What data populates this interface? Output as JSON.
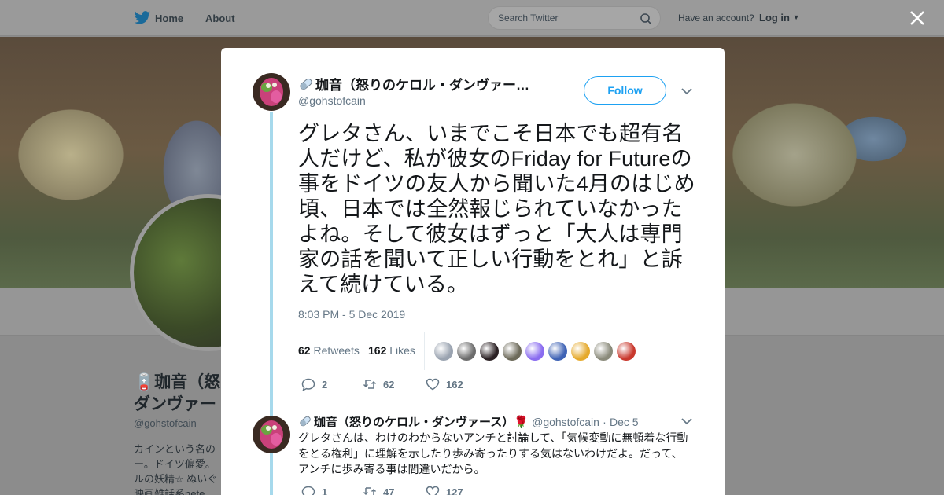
{
  "topbar": {
    "home_label": "Home",
    "about_label": "About",
    "search_placeholder": "Search Twitter",
    "account_question": "Have an account?",
    "login_label": "Log in"
  },
  "profile_bg": {
    "name_line1": "🪫珈音（怒",
    "name_line2": "ダンヴァー",
    "handle": "@gohstofcain",
    "bio_lines": [
      "カインという名の",
      "ー。ドイツ偏愛。",
      "ルの妖精☆ ぬいぐ",
      "映画雑話系nete"
    ]
  },
  "tweet": {
    "author_name": "珈音（怒りのケロル・ダンヴァー…",
    "author_handle": "@gohstofcain",
    "follow_label": "Follow",
    "text": "グレタさん、いまでこそ日本でも超有名人だけど、私が彼女のFriday for Futureの事をドイツの友人から聞いた4月のはじめ頃、日本では全然報じられていなかったよね。そして彼女はずっと「大人は専門家の話を聞いて正しい行動をとれ」と訴えて続けている。",
    "timestamp": "8:03 PM - 5 Dec 2019",
    "retweets_count": "62",
    "retweets_label": "Retweets",
    "likes_count": "162",
    "likes_label": "Likes",
    "replies": "2",
    "retweets": "62",
    "likes": "162",
    "liker_colors": [
      "#9aa3b0",
      "#6c6c6c",
      "#2b2124",
      "#6d6a5a",
      "#8a6cf0",
      "#3f63b5",
      "#e5a92b",
      "#8a8a7a",
      "#c9392e"
    ]
  },
  "reply": {
    "author_name": "珈音（怒りのケロル・ダンヴァース）🌹",
    "author_handle": "@gohstofcain",
    "date": "Dec 5",
    "text": "グレタさんは、わけのわからないアンチと討論して、「気候変動に無頓着な行動をとる権利」に理解を示したり歩み寄ったりする気はないわけだよ。だって、アンチに歩み寄る事は間違いだから。",
    "replies": "1",
    "retweets": "47",
    "likes": "127"
  }
}
